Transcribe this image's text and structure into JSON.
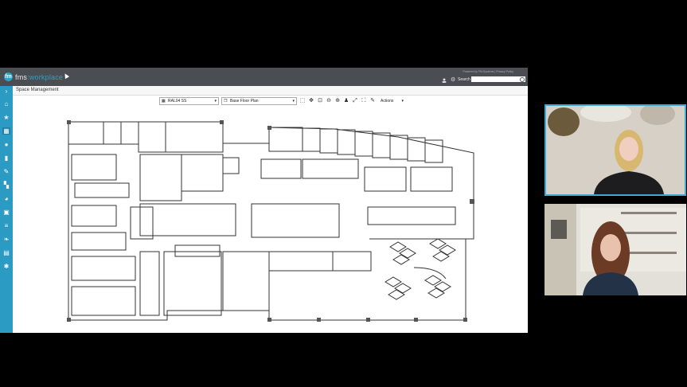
{
  "app": {
    "logo_text_prefix": "fms",
    "logo_text_suffix": ":workplace",
    "powered_by": "Powered by FM:Systems | Privacy Policy",
    "search_label": "Search",
    "search_value": "",
    "breadcrumb": "Space Management"
  },
  "toolbar": {
    "floor_select": "RAL04 SS",
    "plan_select": "Base Floor Plan",
    "actions_label": "Actions"
  },
  "sidebar": {
    "icons": [
      "chevron-right-icon",
      "home-icon",
      "star-icon",
      "calendar-icon",
      "microphone-icon",
      "building-icon",
      "wrench-icon",
      "chart-icon",
      "pie-chart-icon",
      "briefcase-icon",
      "stack-icon",
      "leaf-icon",
      "clipboard-icon",
      "gear-icon"
    ]
  },
  "colors": {
    "sidebar": "#2b9bc4",
    "topbar": "#4a4d52",
    "accent": "#3fa9d6"
  }
}
